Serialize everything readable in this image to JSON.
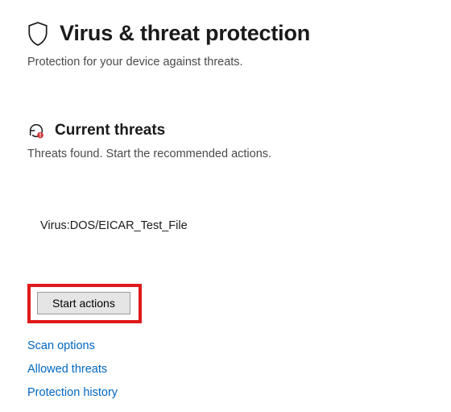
{
  "header": {
    "title": "Virus & threat protection",
    "subtitle": "Protection for your device against threats."
  },
  "threats": {
    "title": "Current threats",
    "subtitle": "Threats found. Start the recommended actions.",
    "items": [
      "Virus:DOS/EICAR_Test_File"
    ],
    "start_actions_label": "Start actions"
  },
  "links": {
    "scan_options": "Scan options",
    "allowed_threats": "Allowed threats",
    "protection_history": "Protection history"
  }
}
